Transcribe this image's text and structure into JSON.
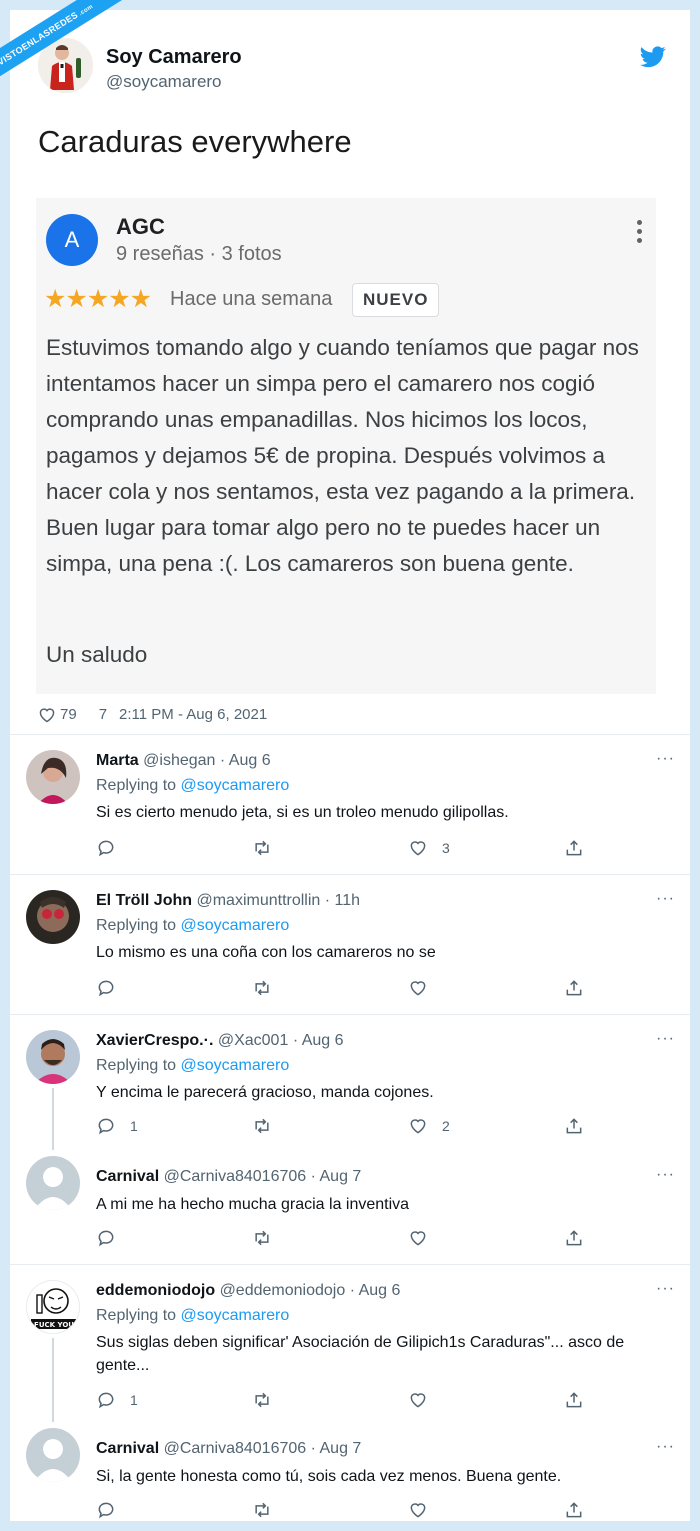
{
  "watermark": {
    "text": "VISTOENLASREDES",
    "suffix": ".com"
  },
  "tweet": {
    "name": "Soy Camarero",
    "handle": "@soycamarero",
    "text": "Caraduras everywhere",
    "likes": "79",
    "retweets": "7",
    "timestamp": "2:11 PM - Aug 6, 2021"
  },
  "review": {
    "avatar_letter": "A",
    "name": "AGC",
    "meta": "9 reseñas · 3 fotos",
    "stars": "★★★★★",
    "rating": 5,
    "date": "Hace una semana",
    "badge": "NUEVO",
    "body": "Estuvimos tomando algo y cuando teníamos que pagar nos intentamos hacer un simpa pero el camarero nos cogió comprando unas empanadillas. Nos hicimos los locos, pagamos y dejamos 5€ de propina. Después volvimos a hacer cola y nos sentamos, esta vez pagando a la primera. Buen lugar para tomar algo pero no te puedes hacer un simpa, una pena :(. Los camareros son buena gente.",
    "sign": "Un saludo"
  },
  "replies": [
    {
      "name": "Marta",
      "handle": "@ishegan",
      "time": "· Aug 6",
      "replying_label": "Replying to",
      "replying_to": "@soycamarero",
      "text": "Si es cierto menudo jeta, si es un troleo menudo gilipollas.",
      "replies": "",
      "retweets": "",
      "likes": "3",
      "more": "···"
    },
    {
      "name": "El Tröll John",
      "handle": "@maximunttrollin",
      "time": "· 11h",
      "replying_label": "Replying to",
      "replying_to": "@soycamarero",
      "text": "Lo mismo es una coña con los camareros no se",
      "replies": "",
      "retweets": "",
      "likes": "",
      "more": "···"
    },
    {
      "name": "XavierCrespo.·.",
      "handle": "@Xac001",
      "time": "· Aug 6",
      "replying_label": "Replying to",
      "replying_to": "@soycamarero",
      "text": "Y encima le parecerá gracioso, manda cojones.",
      "replies": "1",
      "retweets": "",
      "likes": "2",
      "more": "···"
    },
    {
      "name": "Carnival",
      "handle": "@Carniva84016706",
      "time": "· Aug 7",
      "text": "A mi me ha hecho mucha gracia la inventiva",
      "replies": "",
      "retweets": "",
      "likes": "",
      "more": "···"
    },
    {
      "name": "eddemoniodojo",
      "handle": "@eddemoniodojo",
      "time": "· Aug 6",
      "replying_label": "Replying to",
      "replying_to": "@soycamarero",
      "text": "Sus siglas deben significar' Asociación de Gilipich1s Caraduras\"... asco de gente...",
      "replies": "1",
      "retweets": "",
      "likes": "",
      "more": "···",
      "avatar_text": "FUCK YOU"
    },
    {
      "name": "Carnival",
      "handle": "@Carniva84016706",
      "time": "· Aug 7",
      "text": "Si, la gente honesta como tú, sois cada vez menos. Buena gente.",
      "replies": "",
      "retweets": "",
      "likes": "",
      "more": "···"
    }
  ],
  "colors": {
    "accent": "#1d9bf0",
    "review_avatar": "#1a73e8",
    "stars": "#f5a623"
  }
}
